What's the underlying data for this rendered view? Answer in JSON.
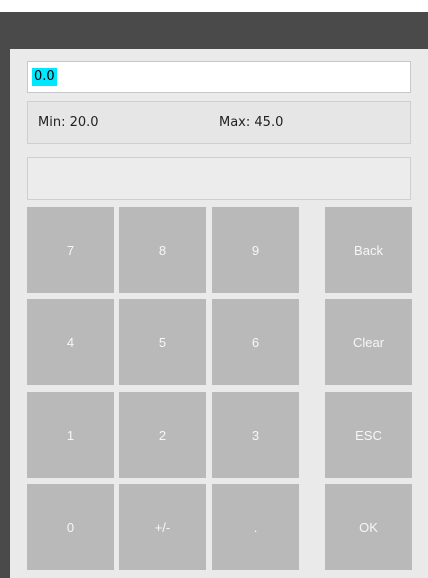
{
  "entry": {
    "value": "0.0"
  },
  "range": {
    "min_label": "Min:",
    "min_value": "20.0",
    "max_label": "Max:",
    "max_value": "45.0"
  },
  "keypad": {
    "rows": [
      [
        "7",
        "8",
        "9",
        "Back"
      ],
      [
        "4",
        "5",
        "6",
        "Clear"
      ],
      [
        "1",
        "2",
        "3",
        "ESC"
      ],
      [
        "0",
        "+/-",
        ".",
        "OK"
      ]
    ]
  },
  "colors": {
    "window_background": "#eaeaea",
    "titlebar": "#4a4a4a",
    "key_background": "#b9b9b9",
    "key_text": "#f7f7f7",
    "selection_highlight": "#00e7ff"
  }
}
